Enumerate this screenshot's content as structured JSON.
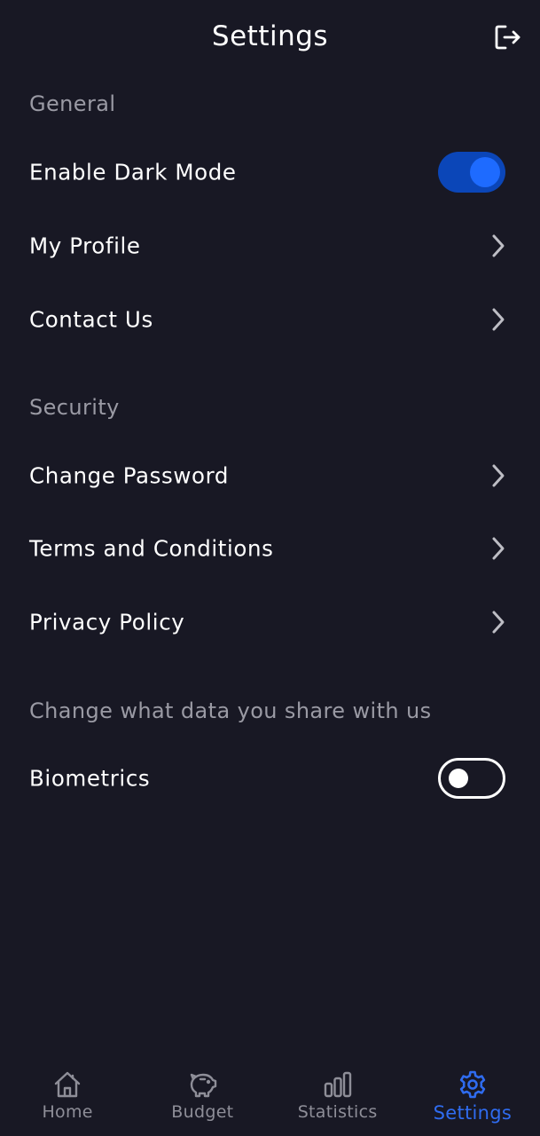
{
  "header": {
    "title": "Settings",
    "logout_icon": "logout-icon"
  },
  "general": {
    "label": "General",
    "dark_mode": {
      "label": "Enable Dark Mode",
      "enabled": true
    },
    "my_profile": {
      "label": "My Profile"
    },
    "contact_us": {
      "label": "Contact Us"
    }
  },
  "security": {
    "label": "Security",
    "change_password": {
      "label": "Change Password"
    },
    "terms": {
      "label": "Terms and Conditions"
    },
    "privacy": {
      "label": "Privacy Policy"
    }
  },
  "data_sharing": {
    "label": "Change what data you share with us",
    "biometrics": {
      "label": "Biometrics",
      "enabled": false
    }
  },
  "bottom_nav": {
    "items": [
      {
        "label": "Home",
        "icon": "home-icon",
        "active": false
      },
      {
        "label": "Budget",
        "icon": "piggy-bank-icon",
        "active": false
      },
      {
        "label": "Statistics",
        "icon": "bar-chart-icon",
        "active": false
      },
      {
        "label": "Settings",
        "icon": "gear-icon",
        "active": true
      }
    ]
  },
  "colors": {
    "background": "#181824",
    "accent": "#2f6cf0",
    "toggle_track_on": "#0b46b8",
    "toggle_knob_on": "#1e6bff",
    "muted_text": "#9a9aa4",
    "nav_inactive": "#8e8e98"
  }
}
